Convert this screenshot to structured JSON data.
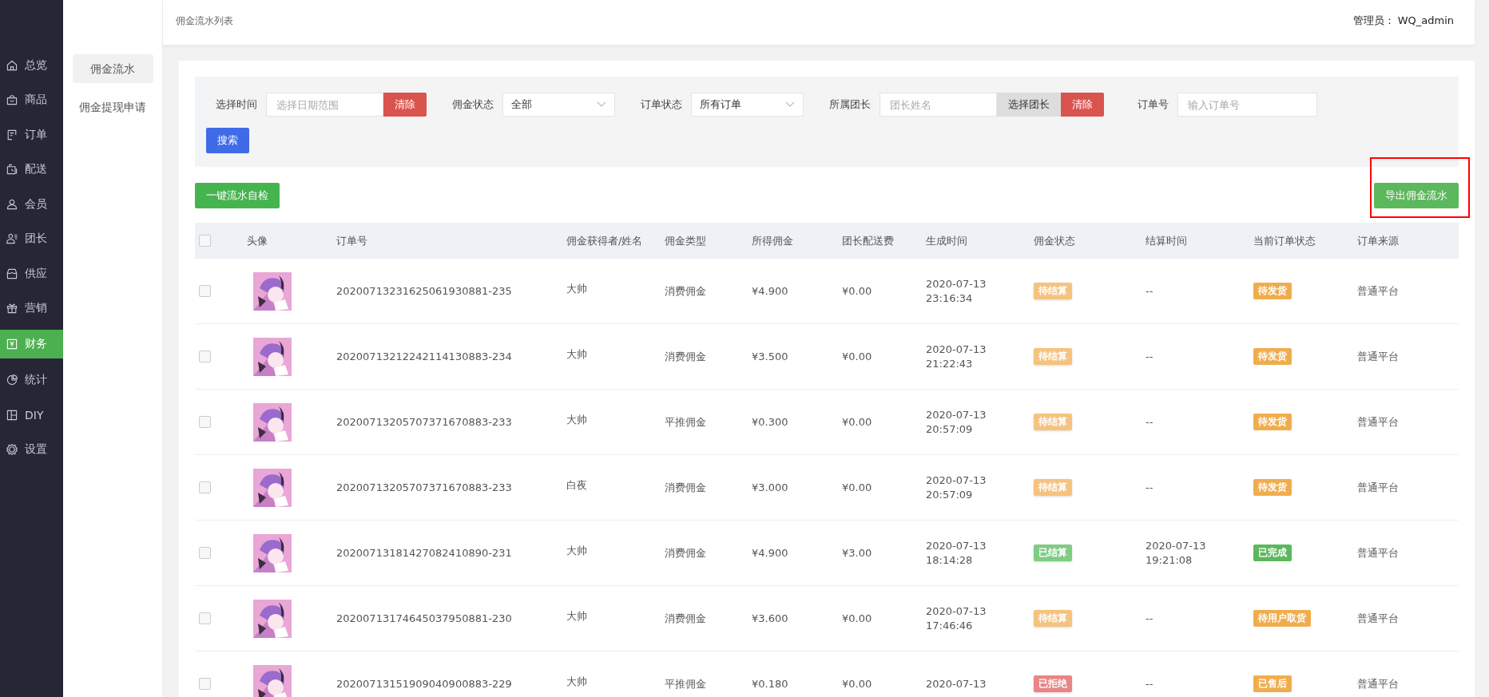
{
  "nav": {
    "items": [
      {
        "label": "总览",
        "selected": false
      },
      {
        "label": "商品",
        "selected": false
      },
      {
        "label": "订单",
        "selected": false
      },
      {
        "label": "配送",
        "selected": false
      },
      {
        "label": "会员",
        "selected": false
      },
      {
        "label": "团长",
        "selected": false
      },
      {
        "label": "供应",
        "selected": false
      },
      {
        "label": "营销",
        "selected": false
      },
      {
        "label": "财务",
        "selected": true
      },
      {
        "label": "统计",
        "selected": false
      },
      {
        "label": "DIY",
        "selected": false
      },
      {
        "label": "设置",
        "selected": false
      }
    ]
  },
  "subnav": {
    "items": [
      {
        "label": "佣金流水",
        "selected": true
      },
      {
        "label": "佣金提现申请",
        "selected": false
      }
    ]
  },
  "header": {
    "title": "佣金流水列表",
    "admin": "管理员： WQ_admin"
  },
  "filters": {
    "time": {
      "label": "选择时间",
      "placeholder": "选择日期范围",
      "clear": "清除"
    },
    "commission_status": {
      "label": "佣金状态",
      "value": "全部"
    },
    "order_status": {
      "label": "订单状态",
      "value": "所有订单"
    },
    "leader": {
      "label": "所属团长",
      "placeholder": "团长姓名",
      "choose": "选择团长",
      "clear": "清除"
    },
    "order_no": {
      "label": "订单号",
      "placeholder": "输入订单号"
    },
    "search": "搜索"
  },
  "actions": {
    "self_check": "一键流水自检",
    "export": "导出佣金流水"
  },
  "table": {
    "columns": [
      "头像",
      "订单号",
      "佣金获得者/姓名",
      "佣金类型",
      "所得佣金",
      "团长配送费",
      "生成时间",
      "佣金状态",
      "结算时间",
      "当前订单状态",
      "订单来源"
    ],
    "header_checked": false,
    "rows": [
      {
        "checked": false,
        "order_no": "20200713231625061930881-235",
        "name": "大帅",
        "type": "消费佣金",
        "commission": "¥4.900",
        "fee": "¥0.00",
        "created": [
          "2020-07-13",
          "23:16:34"
        ],
        "status": {
          "text": "待结算",
          "color": "#f5c37f"
        },
        "settled": [
          "--"
        ],
        "order_status": {
          "text": "待发货",
          "color": "#f0ad4e"
        },
        "source": "普通平台"
      },
      {
        "checked": false,
        "order_no": "20200713212242114130883-234",
        "name": "大帅",
        "type": "消费佣金",
        "commission": "¥3.500",
        "fee": "¥0.00",
        "created": [
          "2020-07-13",
          "21:22:43"
        ],
        "status": {
          "text": "待结算",
          "color": "#f5c37f"
        },
        "settled": [
          "--"
        ],
        "order_status": {
          "text": "待发货",
          "color": "#f0ad4e"
        },
        "source": "普通平台"
      },
      {
        "checked": false,
        "order_no": "20200713205707371670883-233",
        "name": "大帅",
        "type": "平推佣金",
        "commission": "¥0.300",
        "fee": "¥0.00",
        "created": [
          "2020-07-13",
          "20:57:09"
        ],
        "status": {
          "text": "待结算",
          "color": "#f5c37f"
        },
        "settled": [
          "--"
        ],
        "order_status": {
          "text": "待发货",
          "color": "#f0ad4e"
        },
        "source": "普通平台"
      },
      {
        "checked": false,
        "order_no": "20200713205707371670883-233",
        "name": "白夜",
        "type": "消费佣金",
        "commission": "¥3.000",
        "fee": "¥0.00",
        "created": [
          "2020-07-13",
          "20:57:09"
        ],
        "status": {
          "text": "待结算",
          "color": "#f5c37f"
        },
        "settled": [
          "--"
        ],
        "order_status": {
          "text": "待发货",
          "color": "#f0ad4e"
        },
        "source": "普通平台"
      },
      {
        "checked": false,
        "order_no": "20200713181427082410890-231",
        "name": "大帅",
        "type": "消费佣金",
        "commission": "¥4.900",
        "fee": "¥3.00",
        "created": [
          "2020-07-13",
          "18:14:28"
        ],
        "status": {
          "text": "已结算",
          "color": "#7fcc85"
        },
        "settled": [
          "2020-07-13",
          "19:21:08"
        ],
        "order_status": {
          "text": "已完成",
          "color": "#5cb85c"
        },
        "source": "普通平台"
      },
      {
        "checked": false,
        "order_no": "20200713174645037950881-230",
        "name": "大帅",
        "type": "消费佣金",
        "commission": "¥3.600",
        "fee": "¥0.00",
        "created": [
          "2020-07-13",
          "17:46:46"
        ],
        "status": {
          "text": "待结算",
          "color": "#f5c37f"
        },
        "settled": [
          "--"
        ],
        "order_status": {
          "text": "待用户取货",
          "color": "#f0ad4e"
        },
        "source": "普通平台"
      },
      {
        "checked": false,
        "order_no": "20200713151909040900883-229",
        "name": "大帅",
        "type": "平推佣金",
        "commission": "¥0.180",
        "fee": "¥0.00",
        "created": [
          "2020-07-13"
        ],
        "status": {
          "text": "已拒绝",
          "color": "#e98585"
        },
        "settled": [
          "--"
        ],
        "order_status": {
          "text": "已售后",
          "color": "#f0ad4e"
        },
        "source": "普通平台"
      }
    ]
  }
}
